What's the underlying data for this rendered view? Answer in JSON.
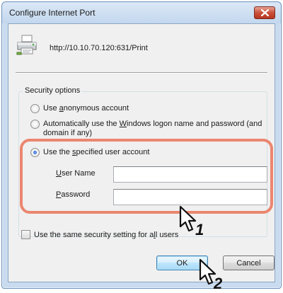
{
  "window": {
    "title": "Configure Internet Port"
  },
  "port": {
    "url": "http://10.10.70.120:631/Print"
  },
  "security": {
    "legend": "Security options",
    "anonymous": {
      "pre": "Use ",
      "key": "a",
      "post": "nonymous account"
    },
    "windows_logon": {
      "pre": "Automatically use the ",
      "key": "W",
      "post": "indows logon name and password (and",
      "line2": "domain if any)"
    },
    "specified": {
      "pre": "Use the ",
      "key": "s",
      "post": "pecified user account"
    },
    "selected_option": "specified"
  },
  "credentials": {
    "user_name": {
      "key": "U",
      "post": "ser Name",
      "value": ""
    },
    "password": {
      "key": "P",
      "post": "assword",
      "value": ""
    }
  },
  "same_security": {
    "pre": "Use the same security setting for a",
    "key": "l",
    "post": "l users",
    "checked": false
  },
  "buttons": {
    "ok": "OK",
    "cancel": "Cancel"
  },
  "annotations": {
    "step1": "1",
    "step2": "2",
    "highlight_color": "#eb8670"
  },
  "colors": {
    "close_button": "#c9503a",
    "focus_button_border": "#3c7fb1"
  },
  "icons": {
    "close": "close-icon",
    "printer": "printer-icon",
    "cursor": "pointer-cursor-icon"
  }
}
